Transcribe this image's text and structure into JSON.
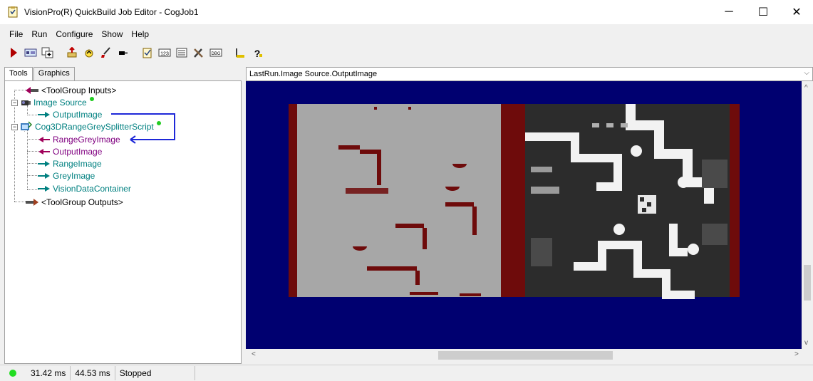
{
  "window": {
    "title": "VisionPro(R) QuickBuild Job Editor - CogJob1",
    "minimize_glyph": "─",
    "maximize_glyph": "☐",
    "close_glyph": "✕"
  },
  "menu": {
    "file": "File",
    "run": "Run",
    "configure": "Configure",
    "show": "Show",
    "help": "Help"
  },
  "toolbar": {
    "icons": [
      "run-icon",
      "display-icon",
      "add-tool-icon",
      "import-icon",
      "reset-icon",
      "brush-icon",
      "link-icon",
      "edit-script-icon",
      "numeric-icon",
      "results-icon",
      "tools-icon",
      "debug-icon",
      "accept-icon",
      "help-icon"
    ],
    "numeric_label": "123",
    "debug_label": "DBG"
  },
  "left_tabs": {
    "tools": "Tools",
    "graphics": "Graphics"
  },
  "tree": {
    "inputs": "<ToolGroup Inputs>",
    "image_source": "Image Source",
    "output_image": "OutputImage",
    "script": "Cog3DRangeGreySplitterScript",
    "range_grey_image": "RangeGreyImage",
    "script_output_image": "OutputImage",
    "range_image": "RangeImage",
    "grey_image": "GreyImage",
    "vision_data_container": "VisionDataContainer",
    "outputs": "<ToolGroup Outputs>"
  },
  "display": {
    "header": "LastRun.Image Source.OutputImage",
    "background_color": "#000070",
    "range_image_color": "#a7a7a7",
    "edge_color": "#6e0b0b"
  },
  "status": {
    "time1": "31.42 ms",
    "time2": "44.53 ms",
    "state": "Stopped",
    "led_color": "#22dd22"
  }
}
